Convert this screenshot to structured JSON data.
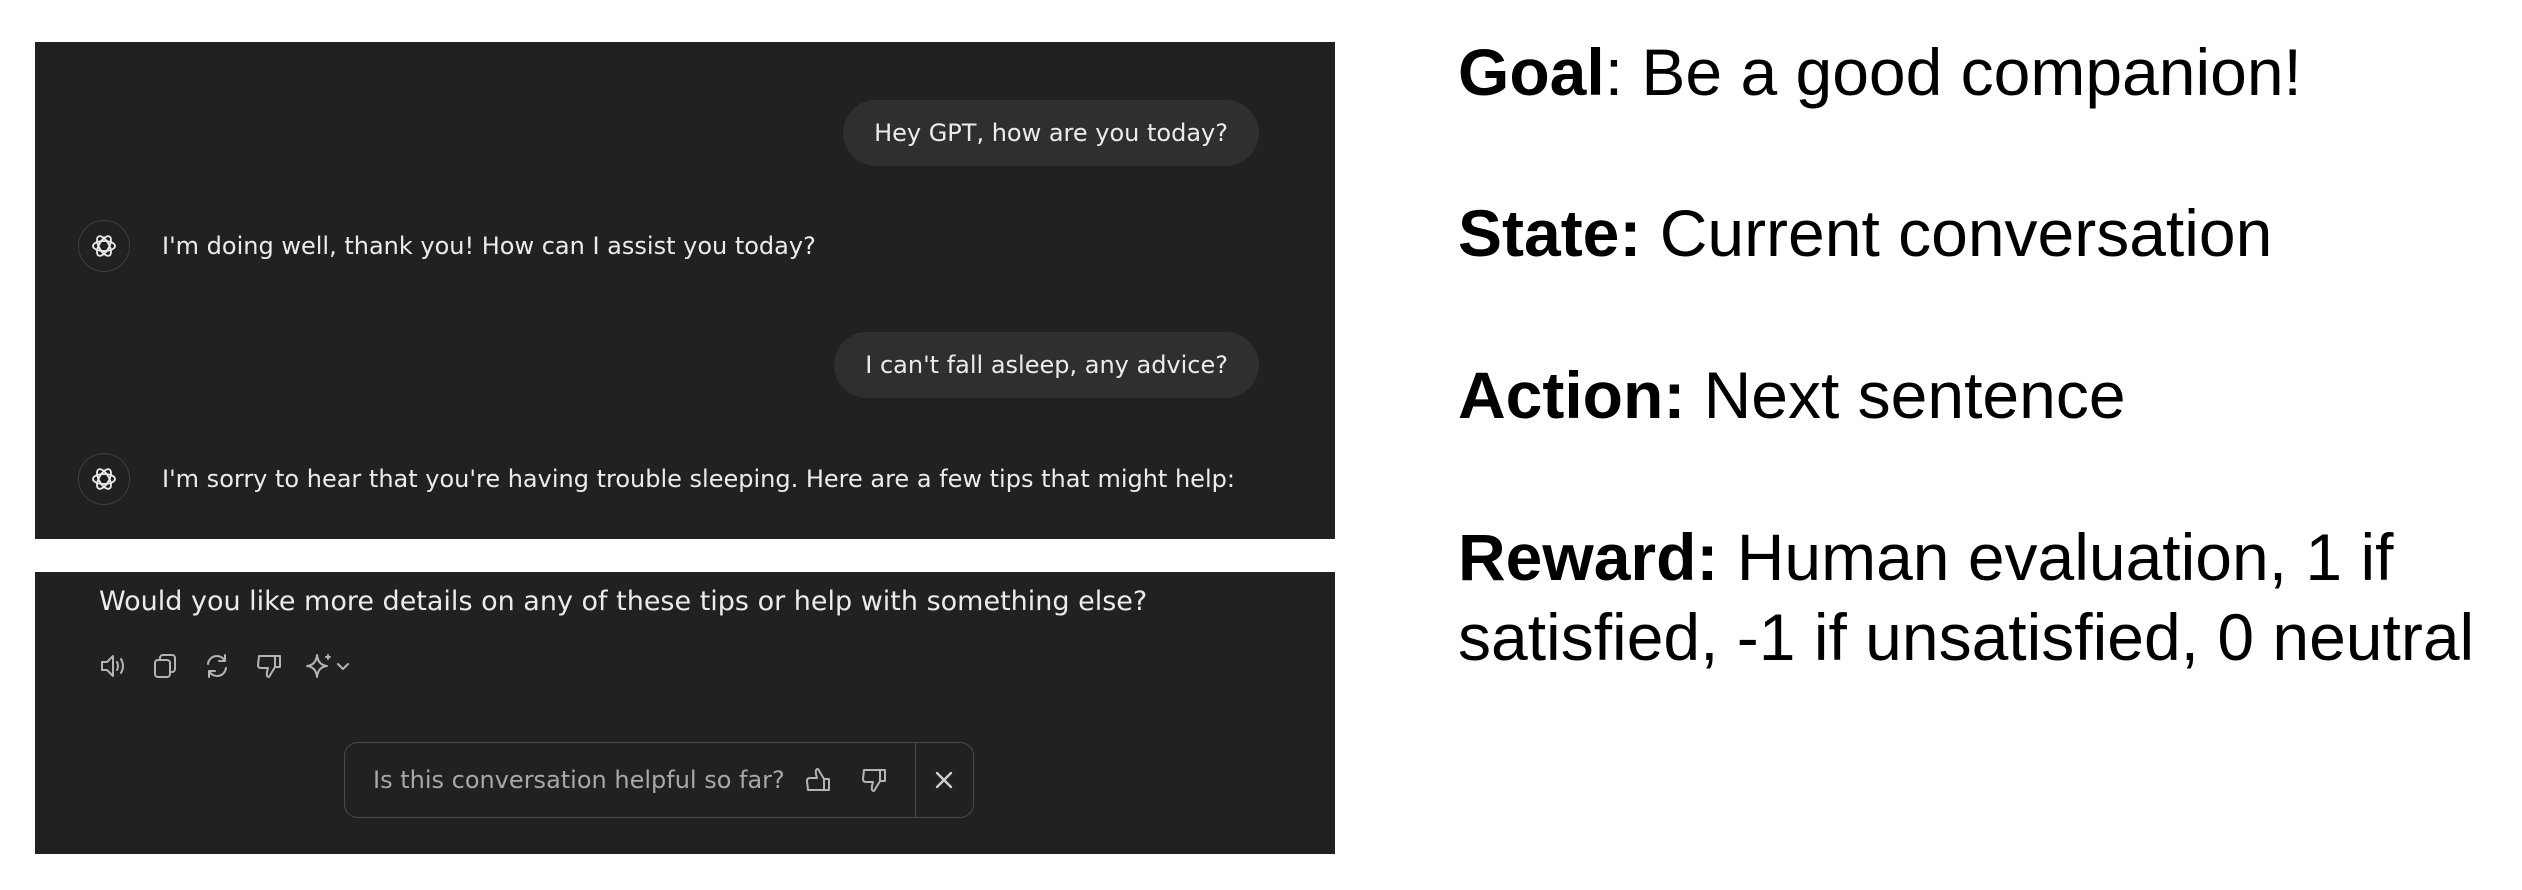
{
  "chat": {
    "messages": [
      {
        "role": "user",
        "text": "Hey GPT, how are you today?"
      },
      {
        "role": "assistant",
        "text": "I'm doing well, thank you! How can I assist you today?"
      },
      {
        "role": "user",
        "text": "I can't fall asleep, any advice?"
      },
      {
        "role": "assistant",
        "text": "I'm sorry to hear that you're having trouble sleeping. Here are a few tips that might help:"
      }
    ],
    "final_message": "Would you like more details on any of these tips or help with something else?",
    "action_icons": [
      "speaker-icon",
      "copy-icon",
      "regenerate-icon",
      "thumbs-down-icon",
      "sparkle-model-icon"
    ],
    "feedback": {
      "question": "Is this conversation helpful so far?",
      "icons": [
        "thumbs-up-icon",
        "thumbs-down-icon",
        "close-icon"
      ]
    },
    "colors": {
      "background": "#212121",
      "user_bubble": "#2f2f2f",
      "text": "#ececec"
    }
  },
  "rl_formulation": {
    "goal": {
      "label": "Goal",
      "text": ": Be a good companion!"
    },
    "state": {
      "label": "State:",
      "text": " Current conversation"
    },
    "action": {
      "label": "Action:",
      "text": " Next sentence"
    },
    "reward": {
      "label": "Reward:",
      "text": " Human evaluation, 1 if",
      "text_line2": "satisfied, -1 if unsatisfied, 0 neutral"
    }
  }
}
